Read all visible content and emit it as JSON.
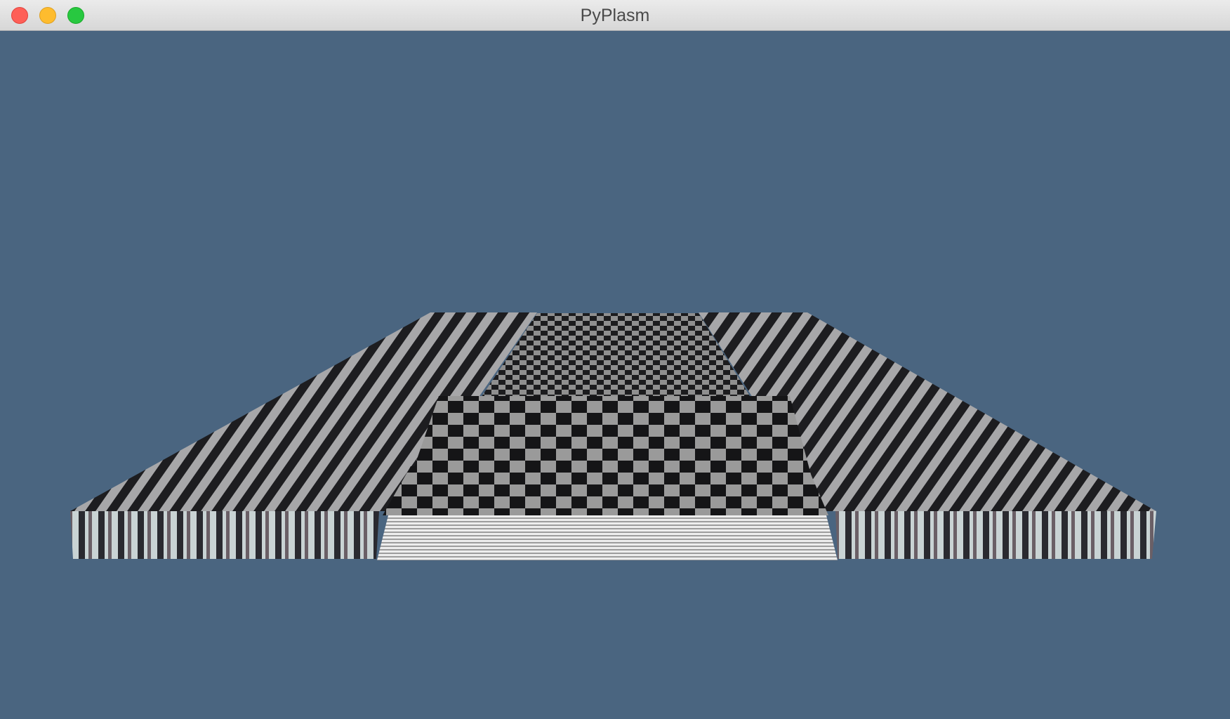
{
  "window": {
    "title": "PyPlasm"
  },
  "controls": {
    "close_icon": "close-icon",
    "minimize_icon": "minimize-icon",
    "zoom_icon": "zoom-icon"
  },
  "colors": {
    "viewport_background": "#4a6580",
    "checker_dark": "#1c1c1e",
    "checker_light": "#8f8f8f",
    "step_face": "#e4e4e4"
  }
}
